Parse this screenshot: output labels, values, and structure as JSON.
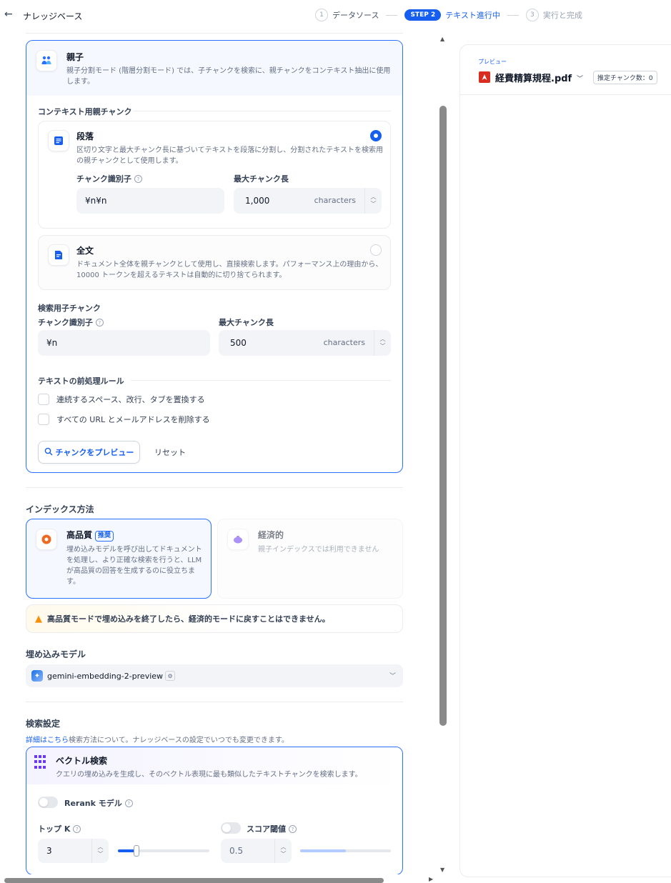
{
  "header": {
    "back_label": "←",
    "title": "ナレッジベース",
    "steps": [
      {
        "number": "1",
        "label": "データソース"
      },
      {
        "number": "STEP 2",
        "label": "テキスト進行中"
      },
      {
        "number": "3",
        "label": "実行と完成"
      }
    ]
  },
  "parent_mode": {
    "title": "親子",
    "description": "親子分割モード (階層分割モード) では、子チャンクを検索に、親チャンクをコンテキスト抽出に使用します。",
    "icon": "parent-child-icon"
  },
  "context_parent": {
    "section_title": "コンテキスト用親チャンク",
    "paragraph": {
      "title": "段落",
      "description": "区切り文字と最大チャンク長に基づいてテキストを段落に分割し、分割されたテキストを検索用の親チャンクとして使用します。",
      "identifier_label": "チャンク識別子",
      "identifier_value": "¥n¥n",
      "max_len_label": "最大チャンク長",
      "max_len_value": "1,000",
      "unit": "characters",
      "selected": true
    },
    "fulltext": {
      "title": "全文",
      "description": "ドキュメント全体を親チャンクとして使用し、直接検索します。パフォーマンス上の理由から、10000 トークンを超えるテキストは自動的に切り捨てられます。",
      "selected": false
    }
  },
  "child_chunk": {
    "section_title": "検索用子チャンク",
    "identifier_label": "チャンク識別子",
    "identifier_value": "¥n",
    "max_len_label": "最大チャンク長",
    "max_len_value": "500",
    "unit": "characters"
  },
  "preprocess": {
    "section_title": "テキストの前処理ルール",
    "rules": [
      {
        "label": "連続するスペース、改行、タブを置換する",
        "checked": false
      },
      {
        "label": "すべての URL とメールアドレスを削除する",
        "checked": false
      }
    ],
    "preview_button": "チャンクをプレビュー",
    "reset_button": "リセット"
  },
  "index_method": {
    "section_title": "インデックス方法",
    "high_quality": {
      "title": "高品質",
      "badge": "推奨",
      "description": "埋め込みモデルを呼び出してドキュメントを処理し、より正確な検索を行うと、LLM が高品質の回答を生成するのに役立ちます。"
    },
    "economical": {
      "title": "経済的",
      "description": "親子インデックスでは利用できません"
    },
    "warning": "高品質モードで埋め込みを終了したら、経済的モードに戻すことはできません。"
  },
  "embedding": {
    "section_title": "埋め込みモデル",
    "model": "gemini-embedding-2-preview"
  },
  "retrieval": {
    "section_title": "検索設定",
    "link_text": "詳細はこちら",
    "hint": "検索方法について。ナレッジベースの設定でいつでも変更できます。",
    "vector": {
      "title": "ベクトル検索",
      "description": "クエリの埋め込みを生成し、そのベクトル表現に最も類似したテキストチャンクを検索します。"
    },
    "rerank_label": "Rerank モデル",
    "rerank_enabled": false,
    "topk_label": "トップ K",
    "topk_value": "3",
    "topk_fraction": 0.2,
    "score_label": "スコア閾値",
    "score_enabled": false,
    "score_value": "0.5",
    "score_fraction": 0.5
  },
  "preview": {
    "label": "プレビュー",
    "file_name": "経費精算規程.pdf",
    "chunk_badge": "推定チャンク数：0"
  },
  "colors": {
    "accent": "#155eef",
    "warning": "#f79009",
    "pdf": "#d92d20"
  }
}
